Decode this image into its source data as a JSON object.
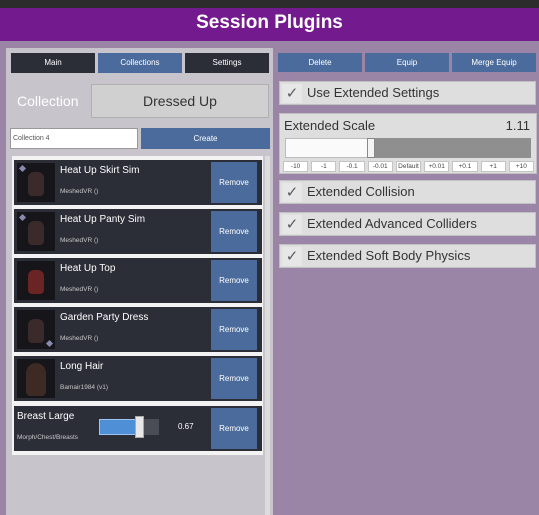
{
  "header": {
    "title": "Session Plugins"
  },
  "left_tabs": [
    {
      "label": "Main"
    },
    {
      "label": "Collections"
    },
    {
      "label": "Settings"
    }
  ],
  "collection": {
    "label": "Collection",
    "value": "Dressed Up",
    "input_value": "Collection 4",
    "create_label": "Create"
  },
  "items": [
    {
      "title": "Heat Up Skirt Sim",
      "subtitle": "MeshedVR ()",
      "remove": "Remove"
    },
    {
      "title": "Heat Up Panty Sim",
      "subtitle": "MeshedVR ()",
      "remove": "Remove"
    },
    {
      "title": "Heat Up Top",
      "subtitle": "MeshedVR ()",
      "remove": "Remove"
    },
    {
      "title": "Garden Party Dress",
      "subtitle": "MeshedVR ()",
      "remove": "Remove"
    },
    {
      "title": "Long Hair",
      "subtitle": "Bamair1984 (v1)",
      "remove": "Remove"
    },
    {
      "title": "Breast Large",
      "subtitle": "Morph/Chest/Breasts",
      "remove": "Remove",
      "slider_value": "0.67",
      "slider_fraction": 0.67
    }
  ],
  "right_buttons": [
    {
      "label": "Delete"
    },
    {
      "label": "Equip"
    },
    {
      "label": "Merge Equip"
    }
  ],
  "use_extended": {
    "label": "Use Extended Settings",
    "checked": true
  },
  "extended_scale": {
    "label": "Extended Scale",
    "value": "1.11",
    "fraction": 0.35,
    "steps": [
      "-10",
      "-1",
      "-0.1",
      "-0.01",
      "Default",
      "+0.01",
      "+0.1",
      "+1",
      "+10"
    ]
  },
  "extended_collision": {
    "label": "Extended Collision",
    "checked": true
  },
  "extended_advanced": {
    "label": "Extended Advanced Colliders",
    "checked": true
  },
  "extended_soft_body": {
    "label": "Extended Soft Body Physics",
    "checked": true
  },
  "colors": {
    "header": "#741a8f",
    "panel": "#9a85a7",
    "button_blue": "#4a6b9b",
    "list_item": "#2b2d37"
  }
}
